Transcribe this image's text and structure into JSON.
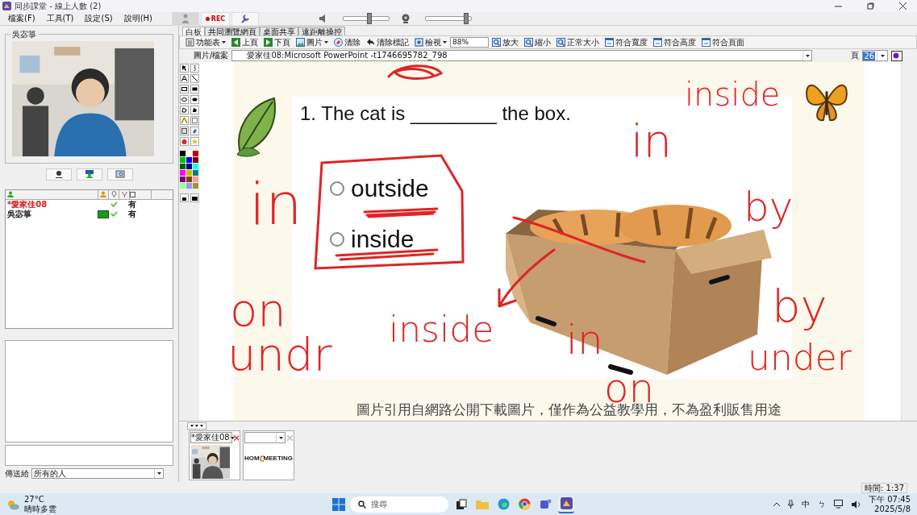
{
  "window": {
    "title": "同步課堂 - 線上人數 (2)"
  },
  "menu": [
    {
      "label": "檔案(F)"
    },
    {
      "label": "工具(T)"
    },
    {
      "label": "設定(S)"
    },
    {
      "label": "說明(H)"
    }
  ],
  "top_toolbar": {
    "rec_label": "REC",
    "speaker": {
      "level": 0.55
    },
    "camera": {
      "level": 0.9
    }
  },
  "video_panel": {
    "title": "吳宓箏"
  },
  "participants": [
    {
      "name": "*愛家佳08",
      "color": "#d42020",
      "video": false,
      "checked": true,
      "status": "有"
    },
    {
      "name": "吳宓箏",
      "color": "#202020",
      "video": true,
      "checked": true,
      "status": "有"
    }
  ],
  "chat": {
    "send_to_label": "傳送給",
    "recipient": "所有的人"
  },
  "tabs": [
    {
      "label": "白板",
      "selected": true
    },
    {
      "label": "共同瀏覽網頁",
      "selected": false
    },
    {
      "label": "桌面共享",
      "selected": false
    },
    {
      "label": "遠距離操控",
      "selected": false
    }
  ],
  "toolbar": [
    {
      "label": "功能表",
      "dropdown": true
    },
    {
      "label": "上頁",
      "dropdown": false
    },
    {
      "label": "下頁",
      "dropdown": false
    },
    {
      "label": "圖片",
      "dropdown": true
    },
    {
      "label": "清除",
      "dropdown": false
    },
    {
      "label": "清除標記",
      "dropdown": false
    },
    {
      "label": "檢視",
      "dropdown": true
    },
    {
      "label": "放大",
      "dropdown": false
    },
    {
      "label": "縮小",
      "dropdown": false
    },
    {
      "label": "正常大小",
      "dropdown": false
    },
    {
      "label": "符合寬度",
      "dropdown": false
    },
    {
      "label": "符合高度",
      "dropdown": false
    },
    {
      "label": "符合頁面",
      "dropdown": false
    }
  ],
  "zoom": "88%",
  "file_bar": {
    "label": "圖片/檔案",
    "value": "愛家佳08:Microsoft PowerPoint -t1746695782_798",
    "page_label": "頁",
    "page": "26"
  },
  "palette": [
    {
      "color": "#000000"
    },
    {
      "color": "#ffffff"
    },
    {
      "color": "#c00000"
    },
    {
      "color": "#00c000"
    },
    {
      "color": "#0000ff"
    },
    {
      "color": "#800000"
    },
    {
      "color": "#006000"
    },
    {
      "color": "#000080"
    },
    {
      "color": "#00ffff"
    },
    {
      "color": "#ff00ff"
    },
    {
      "color": "#c0c000"
    },
    {
      "color": "#008080"
    },
    {
      "color": "#800080"
    },
    {
      "color": "#804000"
    },
    {
      "color": "#ff9999"
    },
    {
      "color": "#99ff99"
    },
    {
      "color": "#9999ff"
    },
    {
      "color": "#999933"
    }
  ],
  "slide": {
    "question": "1. The cat is ________ the box.",
    "options": [
      {
        "label": "outside",
        "selected": false
      },
      {
        "label": "inside",
        "selected": false
      }
    ],
    "caption": "圖片引用自網路公開下載圖片，僅作為公益教學用，不為盈利販售用途"
  },
  "ink_words": [
    {
      "text": "inside"
    },
    {
      "text": "in"
    },
    {
      "text": "in"
    },
    {
      "text": "by"
    },
    {
      "text": "on"
    },
    {
      "text": "undr"
    },
    {
      "text": "inside"
    },
    {
      "text": "in"
    },
    {
      "text": "on"
    },
    {
      "text": "by"
    },
    {
      "text": "under"
    }
  ],
  "thumbnails": [
    {
      "kind": "camera",
      "name": "*愛家佳08"
    },
    {
      "kind": "logo",
      "logo_left": "HOM",
      "logo_right": "MEETING"
    }
  ],
  "status": {
    "time": "時間: 1:37"
  },
  "taskbar": {
    "temperature": "27°C",
    "weather": "晴時多雲",
    "search_placeholder": "搜尋",
    "ime": "中",
    "ime_mode": "ㄅ",
    "time": "下午 07:45",
    "date": "2025/5/8"
  }
}
